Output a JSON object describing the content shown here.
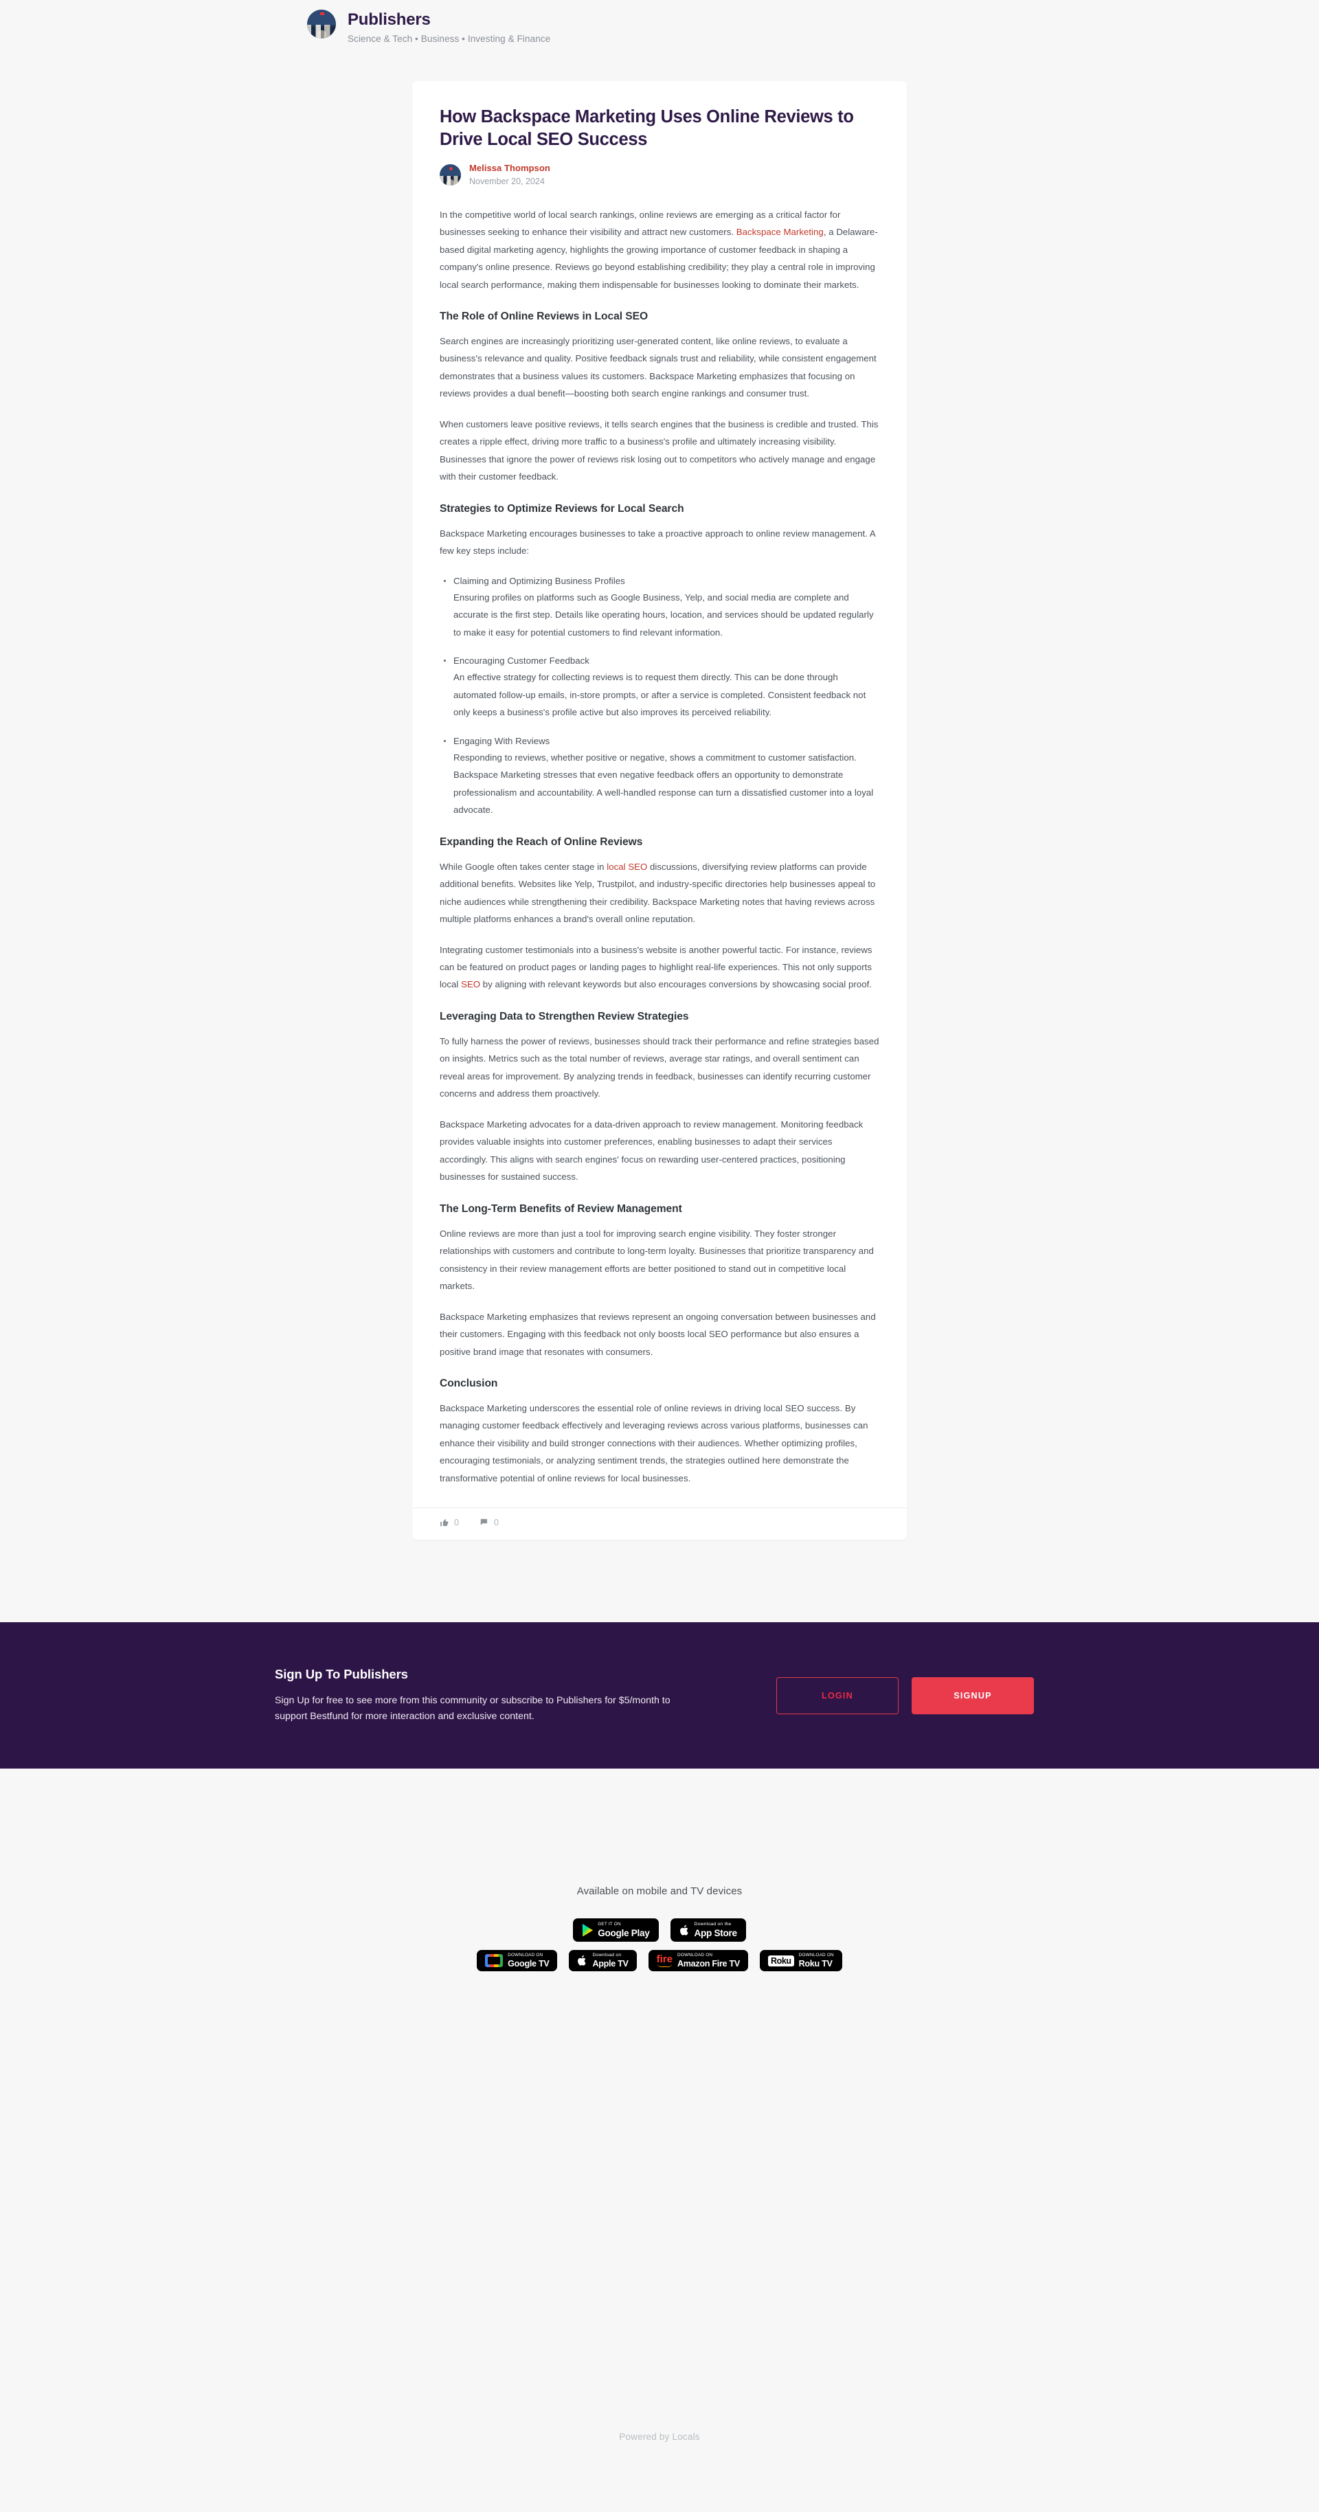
{
  "community": {
    "name": "Publishers",
    "tags": "Science & Tech • Business • Investing & Finance",
    "avatar_icon": "community-avatar-image"
  },
  "post": {
    "title": "How Backspace Marketing Uses Online Reviews to Drive Local SEO Success",
    "author": "Melissa Thompson",
    "date": "November 20, 2024",
    "paragraphs": {
      "intro_1": "In the competitive world of local search rankings, online reviews are emerging as a critical factor for businesses seeking to enhance their visibility and attract new customers. ",
      "intro_link": "Backspace Marketing",
      "intro_2": ", a Delaware-based digital marketing agency, highlights the growing importance of customer feedback in shaping a company's online presence. Reviews go beyond establishing credibility; they play a central role in improving local search performance, making them indispensable for businesses looking to dominate their markets.",
      "role_h2": "The Role of Online Reviews in Local SEO",
      "role_p1": "Search engines are increasingly prioritizing user-generated content, like online reviews, to evaluate a business's relevance and quality. Positive feedback signals trust and reliability, while consistent engagement demonstrates that a business values its customers. Backspace Marketing emphasizes that focusing on reviews provides a dual benefit—boosting both search engine rankings and consumer trust.",
      "role_p2": "When customers leave positive reviews, it tells search engines that the business is credible and trusted. This creates a ripple effect, driving more traffic to a business's profile and ultimately increasing visibility. Businesses that ignore the power of reviews risk losing out to competitors who actively manage and engage with their customer feedback.",
      "strategies_h2": "Strategies to Optimize Reviews for Local Search",
      "strategies_p1": "Backspace Marketing encourages businesses to take a proactive approach to online review management. A few key steps include:",
      "expanding_h2": "Expanding the Reach of Online Reviews",
      "expanding_p1_a": "While Google often takes center stage in ",
      "expanding_p1_link": "local SEO",
      "expanding_p1_b": " discussions, diversifying review platforms can provide additional benefits. Websites like Yelp, Trustpilot, and industry-specific directories help businesses appeal to niche audiences while strengthening their credibility. Backspace Marketing notes that having reviews across multiple platforms enhances a brand's overall online reputation.",
      "expanding_p2_a": "Integrating customer testimonials into a business's website is another powerful tactic. For instance, reviews can be featured on product pages or landing pages to highlight real-life experiences. This not only supports local ",
      "expanding_p2_link": "SEO",
      "expanding_p2_b": " by aligning with relevant keywords but also encourages conversions by showcasing social proof.",
      "leveraging_h2": "Leveraging Data to Strengthen Review Strategies",
      "leveraging_p1": "To fully harness the power of reviews, businesses should track their performance and refine strategies based on insights. Metrics such as the total number of reviews, average star ratings, and overall sentiment can reveal areas for improvement. By analyzing trends in feedback, businesses can identify recurring customer concerns and address them proactively.",
      "leveraging_p2": "Backspace Marketing advocates for a data-driven approach to review management. Monitoring feedback provides valuable insights into customer preferences, enabling businesses to adapt their services accordingly. This aligns with search engines' focus on rewarding user-centered practices, positioning businesses for sustained success.",
      "longterm_h2": "The Long-Term Benefits of Review Management",
      "longterm_p1": "Online reviews are more than just a tool for improving search engine visibility. They foster stronger relationships with customers and contribute to long-term loyalty. Businesses that prioritize transparency and consistency in their review management efforts are better positioned to stand out in competitive local markets.",
      "longterm_p2": "Backspace Marketing emphasizes that reviews represent an ongoing conversation between businesses and their customers. Engaging with this feedback not only boosts local SEO performance but also ensures a positive brand image that resonates with consumers.",
      "conclusion_h2": "Conclusion",
      "conclusion_p1": "Backspace Marketing underscores the essential role of online reviews in driving local SEO success. By managing customer feedback effectively and leveraging reviews across various platforms, businesses can enhance their visibility and build stronger connections with their audiences. Whether optimizing profiles, encouraging testimonials, or analyzing sentiment trends, the strategies outlined here demonstrate the transformative potential of online reviews for local businesses."
    },
    "list_items": [
      {
        "title": "Claiming and Optimizing Business Profiles",
        "desc": "Ensuring profiles on platforms such as Google Business, Yelp, and social media are complete and accurate is the first step. Details like operating hours, location, and services should be updated regularly to make it easy for potential customers to find relevant information."
      },
      {
        "title": "Encouraging Customer Feedback",
        "desc": "An effective strategy for collecting reviews is to request them directly. This can be done through automated follow-up emails, in-store prompts, or after a service is completed. Consistent feedback not only keeps a business's profile active but also improves its perceived reliability."
      },
      {
        "title": "Engaging With Reviews",
        "desc": "Responding to reviews, whether positive or negative, shows a commitment to customer satisfaction. Backspace Marketing stresses that even negative feedback offers an opportunity to demonstrate professionalism and accountability. A well-handled response can turn a dissatisfied customer into a loyal advocate."
      }
    ],
    "stats": {
      "likes": "0",
      "comments": "0",
      "like_icon": "thumbs-up-icon",
      "comment_icon": "comment-icon"
    }
  },
  "signup": {
    "title": "Sign Up To Publishers",
    "description": "Sign Up for free to see more from this community or subscribe to Publishers for $5/month to support Bestfund for more interaction and exclusive content.",
    "login_label": "LOGIN",
    "signup_label": "SIGNUP",
    "background_color": "#2e1547",
    "accent_color": "#ea3b4d"
  },
  "footer": {
    "caption": "Available on mobile and TV devices",
    "badges_row_1": [
      {
        "small": "GET IT ON",
        "big": "Google Play",
        "icon": "google-play-icon"
      },
      {
        "small": "Download on the",
        "big": "App Store",
        "icon": "apple-icon"
      }
    ],
    "badges_row_2": [
      {
        "small": "DOWNLOAD ON",
        "big": "Google TV",
        "icon": "google-tv-icon"
      },
      {
        "small": "Download on",
        "big": "Apple TV",
        "icon": "apple-icon"
      },
      {
        "small": "DOWNLOAD ON",
        "big": "Amazon Fire TV",
        "icon": "amazon-fire-icon"
      },
      {
        "small": "DOWNLOAD ON",
        "big": "Roku TV",
        "icon": "roku-icon"
      }
    ],
    "powered_by": "Powered by Locals"
  }
}
